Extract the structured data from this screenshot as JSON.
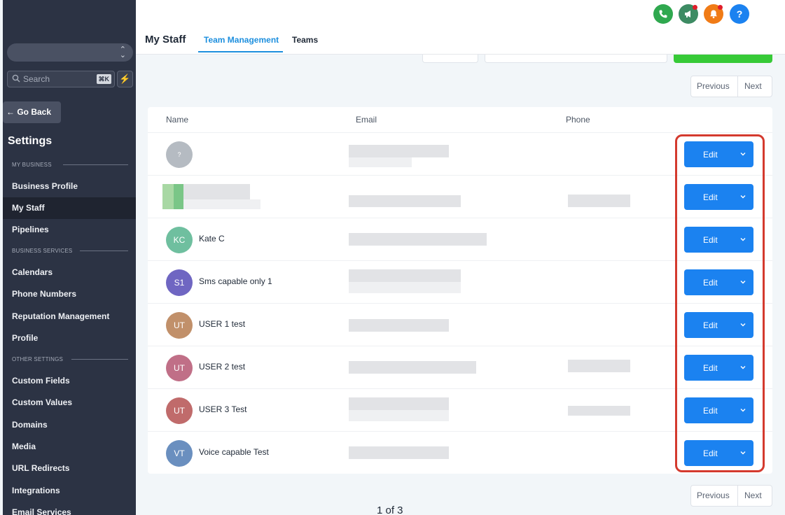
{
  "sidebar": {
    "search_placeholder": "Search",
    "search_shortcut": "⌘K",
    "go_back": "← Go Back",
    "settings_title": "Settings",
    "sections": {
      "my_business": "MY BUSINESS",
      "business_services": "BUSINESS SERVICES",
      "other_settings": "OTHER SETTINGS"
    },
    "items": [
      {
        "label": "Business Profile"
      },
      {
        "label": "My Staff",
        "active": true
      },
      {
        "label": "Pipelines"
      },
      {
        "label": "Calendars"
      },
      {
        "label": "Phone Numbers"
      },
      {
        "label": "Reputation Management"
      },
      {
        "label": "Profile"
      },
      {
        "label": "Custom Fields"
      },
      {
        "label": "Custom Values"
      },
      {
        "label": "Domains"
      },
      {
        "label": "Media"
      },
      {
        "label": "URL Redirects"
      },
      {
        "label": "Integrations"
      },
      {
        "label": "Email Services"
      }
    ]
  },
  "header": {
    "title": "My Staff",
    "tabs": [
      {
        "label": "Team Management",
        "active": true
      },
      {
        "label": "Teams"
      }
    ],
    "icons": [
      {
        "name": "phone-icon",
        "color": "#2fa84f"
      },
      {
        "name": "megaphone-icon",
        "color": "#3d8b63"
      },
      {
        "name": "bell-icon",
        "color": "#f07b16"
      },
      {
        "name": "help-icon",
        "color": "#1b82f0"
      }
    ]
  },
  "pagination": {
    "previous": "Previous",
    "next": "Next",
    "page_info": "1 of 3"
  },
  "table": {
    "columns": [
      "Name",
      "Email",
      "Phone"
    ],
    "rows": [
      {
        "initials": "?",
        "name": "",
        "avatar_color": "#b5bbc2"
      },
      {
        "initials": "",
        "name": "",
        "avatar_color": ""
      },
      {
        "initials": "KC",
        "name": "Kate C",
        "avatar_color": "#6fbf9f"
      },
      {
        "initials": "S1",
        "name": "Sms capable only 1",
        "avatar_color": "#6f66c2"
      },
      {
        "initials": "UT",
        "name": "USER 1 test",
        "avatar_color": "#c1906a"
      },
      {
        "initials": "UT",
        "name": "USER 2 test",
        "avatar_color": "#c06f87"
      },
      {
        "initials": "UT",
        "name": "USER 3 Test",
        "avatar_color": "#c06b6b"
      },
      {
        "initials": "VT",
        "name": "Voice capable Test",
        "avatar_color": "#6a8fbf"
      }
    ],
    "action_label": "Edit"
  },
  "colors": {
    "sidebar_bg": "#2c3344",
    "accent": "#1d8fde",
    "edit_button": "#1b82f0",
    "highlight": "#d43a2e"
  }
}
